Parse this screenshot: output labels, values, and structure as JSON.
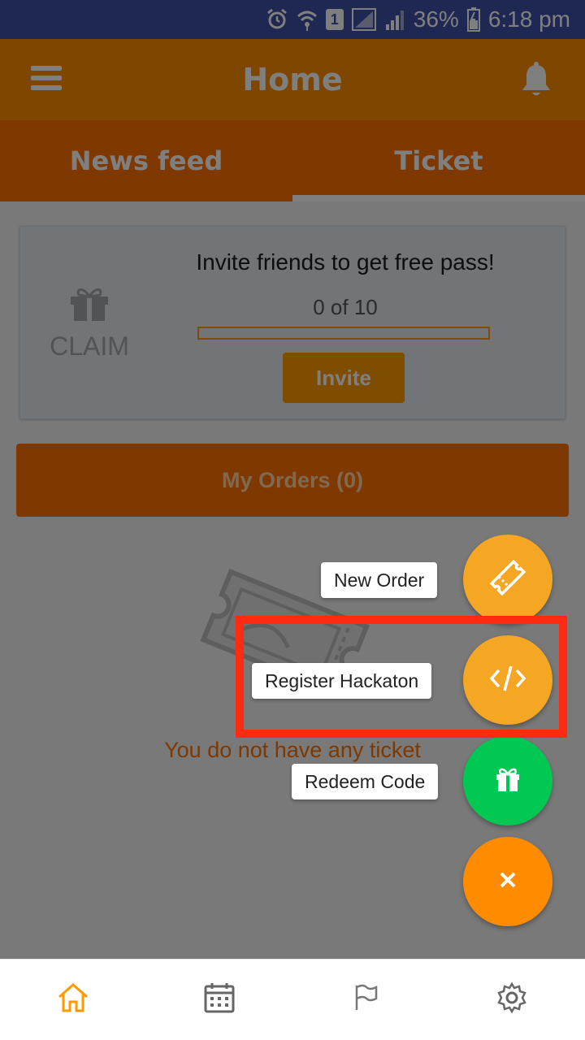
{
  "status_bar": {
    "battery_percent": "36%",
    "time": "6:18 pm",
    "sim_slot": "1",
    "icons": [
      "alarm-icon",
      "wifi-icon",
      "sim-icon",
      "signal-icon",
      "signal-icon",
      "battery-icon"
    ]
  },
  "app_bar": {
    "title": "Home",
    "menu_icon": "menu-icon",
    "notification_icon": "bell-icon"
  },
  "tabs": [
    {
      "label": "News feed",
      "active": false
    },
    {
      "label": "Ticket",
      "active": true
    }
  ],
  "invite_card": {
    "claim_label": "CLAIM",
    "claim_icon": "gift-icon",
    "title": "Invite friends to get free pass!",
    "progress_text": "0 of 10",
    "progress_current": 0,
    "progress_total": 10,
    "invite_button": "Invite"
  },
  "orders": {
    "label": "My Orders (0)"
  },
  "empty_state": {
    "message": "You do not have any ticket",
    "illustration": "ticket-icon"
  },
  "fab_menu": {
    "items": [
      {
        "label": "New Order",
        "icon": "ticket-icon",
        "color": "#f5a623"
      },
      {
        "label": "Register Hackaton",
        "icon": "code-icon",
        "color": "#f5a623"
      },
      {
        "label": "Redeem Code",
        "icon": "gift-icon",
        "color": "#00c853"
      }
    ],
    "main_button_icon": "close-icon",
    "main_button_color": "#ff8c00"
  },
  "bottom_nav": {
    "items": [
      {
        "icon": "home-icon",
        "active": true
      },
      {
        "icon": "calendar-icon",
        "active": false
      },
      {
        "icon": "flag-icon",
        "active": false
      },
      {
        "icon": "settings-icon",
        "active": false
      }
    ]
  },
  "colors": {
    "status_bar": "#3f51a5",
    "app_bar": "#ff8c00",
    "tab_bar": "#ff7300",
    "accent": "#ff9a00",
    "highlight": "#ff2a12"
  }
}
